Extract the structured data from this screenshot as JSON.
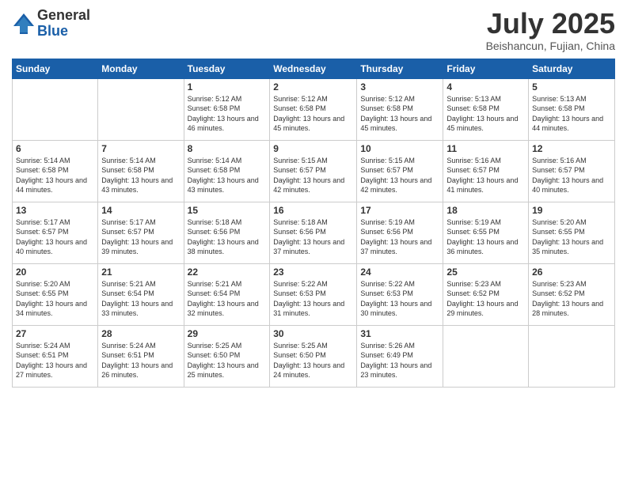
{
  "logo": {
    "general": "General",
    "blue": "Blue"
  },
  "title": "July 2025",
  "location": "Beishancun, Fujian, China",
  "headers": [
    "Sunday",
    "Monday",
    "Tuesday",
    "Wednesday",
    "Thursday",
    "Friday",
    "Saturday"
  ],
  "weeks": [
    [
      {
        "day": "",
        "info": ""
      },
      {
        "day": "",
        "info": ""
      },
      {
        "day": "1",
        "info": "Sunrise: 5:12 AM\nSunset: 6:58 PM\nDaylight: 13 hours and 46 minutes."
      },
      {
        "day": "2",
        "info": "Sunrise: 5:12 AM\nSunset: 6:58 PM\nDaylight: 13 hours and 45 minutes."
      },
      {
        "day": "3",
        "info": "Sunrise: 5:12 AM\nSunset: 6:58 PM\nDaylight: 13 hours and 45 minutes."
      },
      {
        "day": "4",
        "info": "Sunrise: 5:13 AM\nSunset: 6:58 PM\nDaylight: 13 hours and 45 minutes."
      },
      {
        "day": "5",
        "info": "Sunrise: 5:13 AM\nSunset: 6:58 PM\nDaylight: 13 hours and 44 minutes."
      }
    ],
    [
      {
        "day": "6",
        "info": "Sunrise: 5:14 AM\nSunset: 6:58 PM\nDaylight: 13 hours and 44 minutes."
      },
      {
        "day": "7",
        "info": "Sunrise: 5:14 AM\nSunset: 6:58 PM\nDaylight: 13 hours and 43 minutes."
      },
      {
        "day": "8",
        "info": "Sunrise: 5:14 AM\nSunset: 6:58 PM\nDaylight: 13 hours and 43 minutes."
      },
      {
        "day": "9",
        "info": "Sunrise: 5:15 AM\nSunset: 6:57 PM\nDaylight: 13 hours and 42 minutes."
      },
      {
        "day": "10",
        "info": "Sunrise: 5:15 AM\nSunset: 6:57 PM\nDaylight: 13 hours and 42 minutes."
      },
      {
        "day": "11",
        "info": "Sunrise: 5:16 AM\nSunset: 6:57 PM\nDaylight: 13 hours and 41 minutes."
      },
      {
        "day": "12",
        "info": "Sunrise: 5:16 AM\nSunset: 6:57 PM\nDaylight: 13 hours and 40 minutes."
      }
    ],
    [
      {
        "day": "13",
        "info": "Sunrise: 5:17 AM\nSunset: 6:57 PM\nDaylight: 13 hours and 40 minutes."
      },
      {
        "day": "14",
        "info": "Sunrise: 5:17 AM\nSunset: 6:57 PM\nDaylight: 13 hours and 39 minutes."
      },
      {
        "day": "15",
        "info": "Sunrise: 5:18 AM\nSunset: 6:56 PM\nDaylight: 13 hours and 38 minutes."
      },
      {
        "day": "16",
        "info": "Sunrise: 5:18 AM\nSunset: 6:56 PM\nDaylight: 13 hours and 37 minutes."
      },
      {
        "day": "17",
        "info": "Sunrise: 5:19 AM\nSunset: 6:56 PM\nDaylight: 13 hours and 37 minutes."
      },
      {
        "day": "18",
        "info": "Sunrise: 5:19 AM\nSunset: 6:55 PM\nDaylight: 13 hours and 36 minutes."
      },
      {
        "day": "19",
        "info": "Sunrise: 5:20 AM\nSunset: 6:55 PM\nDaylight: 13 hours and 35 minutes."
      }
    ],
    [
      {
        "day": "20",
        "info": "Sunrise: 5:20 AM\nSunset: 6:55 PM\nDaylight: 13 hours and 34 minutes."
      },
      {
        "day": "21",
        "info": "Sunrise: 5:21 AM\nSunset: 6:54 PM\nDaylight: 13 hours and 33 minutes."
      },
      {
        "day": "22",
        "info": "Sunrise: 5:21 AM\nSunset: 6:54 PM\nDaylight: 13 hours and 32 minutes."
      },
      {
        "day": "23",
        "info": "Sunrise: 5:22 AM\nSunset: 6:53 PM\nDaylight: 13 hours and 31 minutes."
      },
      {
        "day": "24",
        "info": "Sunrise: 5:22 AM\nSunset: 6:53 PM\nDaylight: 13 hours and 30 minutes."
      },
      {
        "day": "25",
        "info": "Sunrise: 5:23 AM\nSunset: 6:52 PM\nDaylight: 13 hours and 29 minutes."
      },
      {
        "day": "26",
        "info": "Sunrise: 5:23 AM\nSunset: 6:52 PM\nDaylight: 13 hours and 28 minutes."
      }
    ],
    [
      {
        "day": "27",
        "info": "Sunrise: 5:24 AM\nSunset: 6:51 PM\nDaylight: 13 hours and 27 minutes."
      },
      {
        "day": "28",
        "info": "Sunrise: 5:24 AM\nSunset: 6:51 PM\nDaylight: 13 hours and 26 minutes."
      },
      {
        "day": "29",
        "info": "Sunrise: 5:25 AM\nSunset: 6:50 PM\nDaylight: 13 hours and 25 minutes."
      },
      {
        "day": "30",
        "info": "Sunrise: 5:25 AM\nSunset: 6:50 PM\nDaylight: 13 hours and 24 minutes."
      },
      {
        "day": "31",
        "info": "Sunrise: 5:26 AM\nSunset: 6:49 PM\nDaylight: 13 hours and 23 minutes."
      },
      {
        "day": "",
        "info": ""
      },
      {
        "day": "",
        "info": ""
      }
    ]
  ]
}
